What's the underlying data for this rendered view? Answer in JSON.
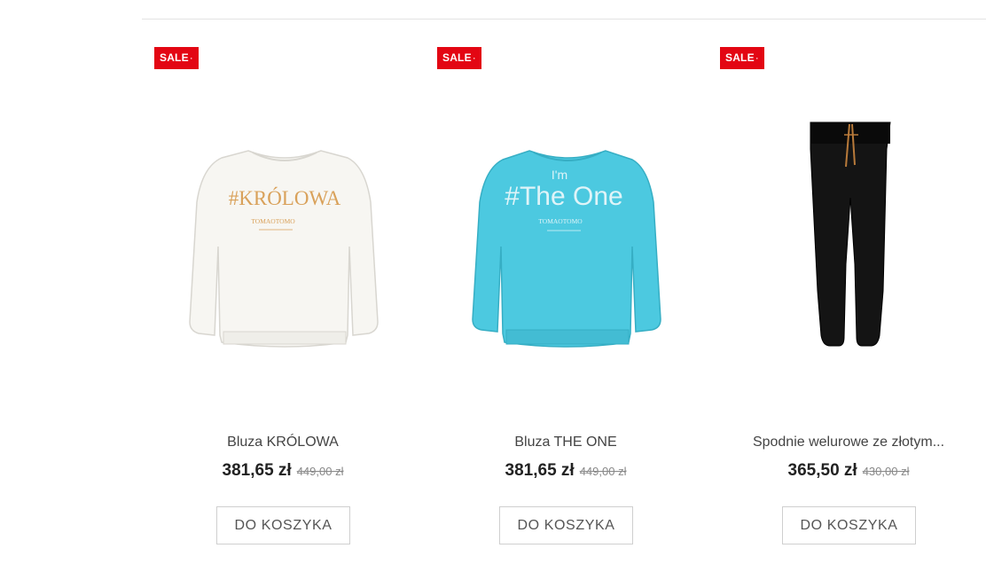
{
  "products": [
    {
      "badge": "SALE",
      "image_icon": "white-sweatshirt-krolowa-image",
      "name": "Bluza KRÓLOWA",
      "price": "381,65 zł",
      "old_price": "449,00 zł",
      "cart_label": "DO KOSZYKA",
      "print_text": "#KRÓLOWA",
      "brand_text": "TOMAOTOMO",
      "garment_color": "#f7f6f2",
      "print_color": "#d9a15a"
    },
    {
      "badge": "SALE",
      "image_icon": "turquoise-sweatshirt-the-one-image",
      "name": "Bluza THE ONE",
      "price": "381,65 zł",
      "old_price": "449,00 zł",
      "cart_label": "DO KOSZYKA",
      "print_text_top": "I'm",
      "print_text": "#The One",
      "brand_text": "TOMAOTOMO",
      "garment_color": "#4cc9e0",
      "print_color": "#dff4f8"
    },
    {
      "badge": "SALE",
      "image_icon": "black-velour-pants-image",
      "name": "Spodnie welurowe ze złotym...",
      "price": "365,50 zł",
      "old_price": "430,00 zł",
      "cart_label": "DO KOSZYKA",
      "garment_color": "#141414",
      "print_color": "#b87a3a"
    }
  ],
  "colors": {
    "sale_badge": "#e30613",
    "button_border": "#cfcfcf"
  }
}
